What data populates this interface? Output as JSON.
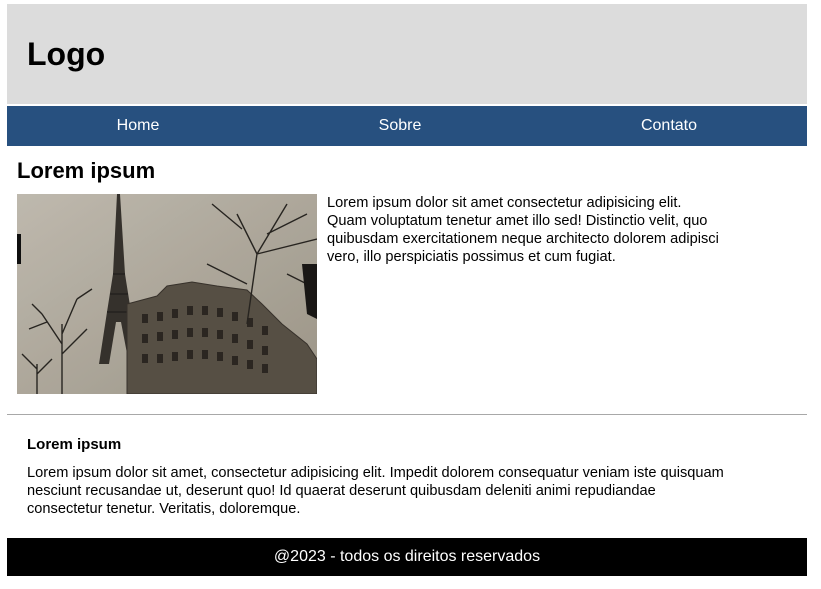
{
  "header": {
    "logo": "Logo"
  },
  "nav": {
    "items": [
      {
        "label": "Home"
      },
      {
        "label": "Sobre"
      },
      {
        "label": "Contato"
      }
    ]
  },
  "main": {
    "title": "Lorem ipsum",
    "image": {
      "subject": "eiffel-tower-photo"
    },
    "text": "Lorem ipsum dolor sit amet consectetur adipisicing elit. Quam voluptatum tenetur amet illo sed! Distinctio velit, quo quibusdam exercitationem neque architecto dolorem adipisci vero, illo perspiciatis possimus et cum fugiat."
  },
  "aside": {
    "title": "Lorem ipsum",
    "text": "Lorem ipsum dolor sit amet, consectetur adipisicing elit. Impedit dolorem consequatur veniam iste quisquam nesciunt recusandae ut, deserunt quo! Id quaerat deserunt quibusdam deleniti animi repudiandae consectetur tenetur. Veritatis, doloremque."
  },
  "footer": {
    "text": "@2023 - todos os direitos reservados"
  },
  "colors": {
    "header_bg": "#dcdcdc",
    "nav_bg": "#27507f",
    "footer_bg": "#000000"
  }
}
